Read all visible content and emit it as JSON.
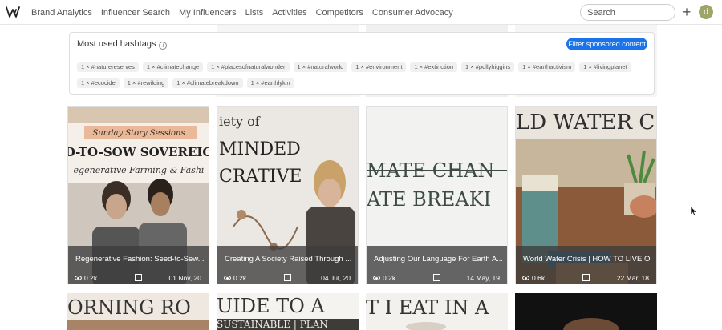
{
  "nav": {
    "links": [
      "Brand Analytics",
      "Influencer Search",
      "My Influencers",
      "Lists",
      "Activities",
      "Competitors",
      "Consumer Advocacy"
    ],
    "search_placeholder": "Search",
    "avatar_letter": "d"
  },
  "hashtags": {
    "title": "Most used hashtags",
    "filter_label": "Filter sponsored content",
    "items": [
      "1 × #naturereserves",
      "1 × #climatechange",
      "1 × #placesofnaturalwonder",
      "1 × #naturalworld",
      "1 × #environment",
      "1 × #extinction",
      "1 × #pollyhiggins",
      "1 × #earthactivism",
      "1 × #livingplanet",
      "1 × #ecocide",
      "1 × #rewilding",
      "1 × #climatebreakdown",
      "1 × #earthlykin"
    ]
  },
  "cards": [
    {
      "title": "Regenerative Fashion: Seed-to-Sew...",
      "views": "0.2k",
      "date": "01 Nov, 20",
      "img_lines": [
        "Sunday Story Sessions",
        "D-TO-SOW SOVEREIG",
        "egenerative Farming & Fashi"
      ]
    },
    {
      "title": "Creating A Society Raised Through ...",
      "views": "0.2k",
      "date": "04 Jul, 20",
      "img_lines": [
        "iety of",
        "MINDED",
        "CRATIVE"
      ]
    },
    {
      "title": "Adjusting Our Language For Earth A...",
      "views": "0.2k",
      "date": "14 May, 19",
      "img_lines": [
        "MATE CHAN",
        "ATE BREAKI"
      ]
    },
    {
      "title": "World Water Crisis | HOW TO LIVE O...",
      "views": "0.6k",
      "date": "22 Mar, 18",
      "img_lines": [
        "LD WATER C"
      ]
    }
  ],
  "bottom_cards": [
    {
      "img_lines": [
        "ORNING RO"
      ]
    },
    {
      "img_lines": [
        "UIDE TO A",
        "SUSTAINABLE | PLAN"
      ]
    },
    {
      "img_lines": [
        "T I EAT IN A"
      ]
    },
    {
      "img_lines": []
    }
  ],
  "colors": {
    "accent": "#1a73e8",
    "avatar": "#9ea567",
    "overlay": "#3c3c3c"
  }
}
